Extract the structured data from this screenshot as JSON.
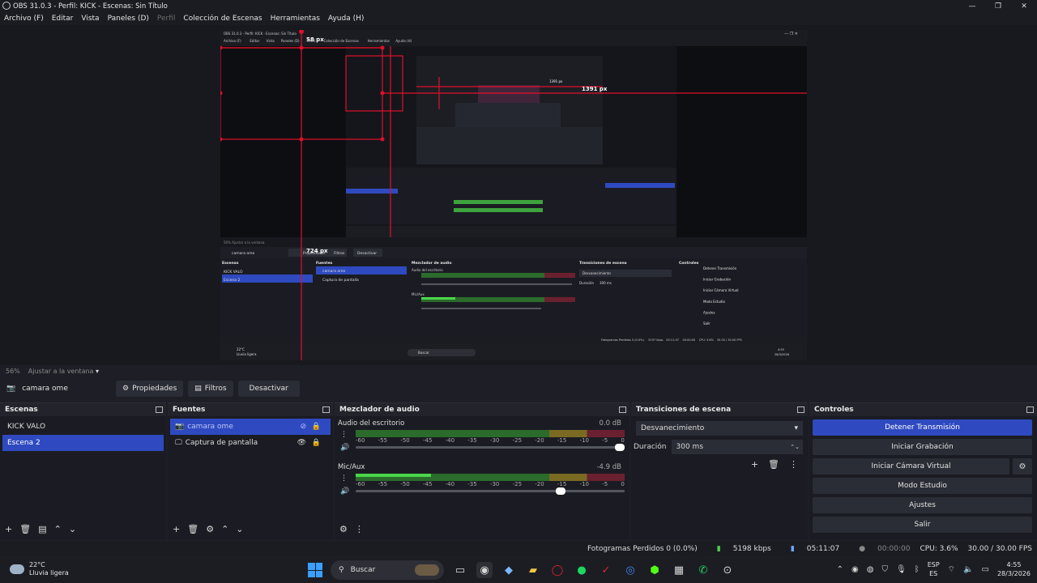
{
  "window": {
    "title": "OBS 31.0.3 - Perfil: KICK - Escenas: Sin Título",
    "minimize": "—",
    "maximize": "❐",
    "close": "✕"
  },
  "menu": {
    "archivo": "Archivo (F)",
    "editar": "Editar",
    "vista": "Vista",
    "paneles": "Paneles (D)",
    "perfil": "Perfil",
    "coleccion": "Colección de Escenas",
    "herramientas": "Herramientas",
    "ayuda": "Ayuda (H)"
  },
  "preview": {
    "inner_title": "OBS 31.0.3 - Perfil: KICK - Escenas: Sin Título",
    "inner_menu": [
      "Archivo (F)",
      "Editar",
      "Vista",
      "Paneles (D)",
      "Perfil",
      "Colección de Escenas",
      "Herramientas",
      "Ayuda (H)"
    ],
    "measure_top": "58 px",
    "measure_right": "1391 px",
    "measure_left": "724 px",
    "inner_mid_label": "1391 px",
    "inner_zoom": "56%  Ajustar a la ventana",
    "inner_source": "camara ome",
    "inner_props": "Propiedades",
    "inner_filters": "Filtros",
    "inner_deactivate": "Desactivar",
    "inner_docks": [
      "Escenas",
      "Fuentes",
      "Mezclador de audio",
      "Transiciones de escena",
      "Controles"
    ],
    "inner_scenes": [
      "KICK VALO",
      "Escena 2"
    ],
    "inner_sources": [
      "camara ome",
      "Captura de pantalla"
    ],
    "inner_channels": [
      "Audio del escritorio",
      "Mic/Aux"
    ],
    "inner_trans": "Desvanecimiento",
    "inner_dur_label": "Duración",
    "inner_dur": "300 ms",
    "inner_controls": [
      "Detener Transmisión",
      "Iniciar Grabación",
      "Iniciar Cámara Virtual",
      "Modo Estudio",
      "Ajustes",
      "Salir"
    ],
    "inner_status": [
      "Fotogramas Perdidos 0 (0.0%)",
      "5197 kbps",
      "05:11:07",
      "00:00:00",
      "CPU: 3.6%",
      "30.00 / 30.00 FPS"
    ],
    "inner_weather": [
      "22°C",
      "Lluvia ligera"
    ],
    "inner_search": "Buscar",
    "inner_clock": [
      "4:55",
      "28/3/2026"
    ]
  },
  "zoom": {
    "value": "56%",
    "fit": "Ajustar a la ventana"
  },
  "source_toolbar": {
    "source_name": "camara ome",
    "properties": "Propiedades",
    "filters": "Filtros",
    "deactivate": "Desactivar"
  },
  "scenes": {
    "title": "Escenas",
    "items": [
      "KICK VALO",
      "Escena 2"
    ],
    "selected": 1
  },
  "sources": {
    "title": "Fuentes",
    "items": [
      {
        "name": "camara ome",
        "icon": "camera-icon"
      },
      {
        "name": "Captura de pantalla",
        "icon": "monitor-icon"
      }
    ],
    "selected": 0
  },
  "mixer": {
    "title": "Mezclador de audio",
    "scale": [
      "-60",
      "-55",
      "-50",
      "-45",
      "-40",
      "-35",
      "-30",
      "-25",
      "-20",
      "-15",
      "-10",
      "-5",
      "0"
    ],
    "channels": [
      {
        "name": "Audio del escritorio",
        "db": "0.0 dB",
        "level": 0.0,
        "volume": 1.0
      },
      {
        "name": "Mic/Aux",
        "db": "-4.9 dB",
        "level": 0.28,
        "volume": 0.78
      }
    ]
  },
  "transitions": {
    "title": "Transiciones de escena",
    "type": "Desvanecimiento",
    "duration_label": "Duración",
    "duration": "300 ms"
  },
  "controls": {
    "title": "Controles",
    "stop_stream": "Detener Transmisión",
    "start_rec": "Iniciar Grabación",
    "start_vcam": "Iniciar Cámara Virtual",
    "studio": "Modo Estudio",
    "settings": "Ajustes",
    "exit": "Salir"
  },
  "status": {
    "dropped": "Fotogramas Perdidos 0 (0.0%)",
    "bitrate": "5198 kbps",
    "stream_time": "05:11:07",
    "rec_time": "00:00:00",
    "cpu": "CPU: 3.6%",
    "fps": "30.00 / 30.00 FPS"
  },
  "taskbar": {
    "temp": "22°C",
    "weather": "Lluvia ligera",
    "search": "Buscar",
    "lang1": "ESP",
    "lang2": "ES",
    "time": "4:55",
    "date": "28/3/2026"
  },
  "colors": {
    "accent": "#2f4ac0",
    "measure": "#e0102a",
    "meter_green": "#4bd64b"
  }
}
